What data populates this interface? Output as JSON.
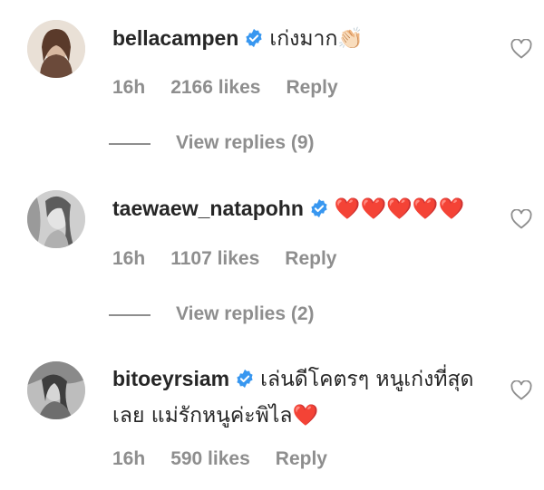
{
  "comments": [
    {
      "username": "bellacampen",
      "text": "เก่งมาก👏🏻",
      "time": "16h",
      "likes": "2166 likes",
      "reply_label": "Reply",
      "view_replies": "View replies (9)"
    },
    {
      "username": "taewaew_natapohn",
      "text": "❤️❤️❤️❤️❤️",
      "time": "16h",
      "likes": "1107 likes",
      "reply_label": "Reply",
      "view_replies": "View replies (2)"
    },
    {
      "username": "bitoeyrsiam",
      "text": "เล่นดีโคตรๆ หนูเก่งที่สุดเลย แม่รักหนูค่ะพิไล❤️",
      "time": "16h",
      "likes": "590 likes",
      "reply_label": "Reply"
    }
  ],
  "colors": {
    "text": "#262626",
    "muted": "#8e8e8e",
    "verified": "#3897f0",
    "heart": "#e0245e"
  },
  "icons": {
    "verified": "verified-badge-icon",
    "like": "heart-outline-icon"
  }
}
